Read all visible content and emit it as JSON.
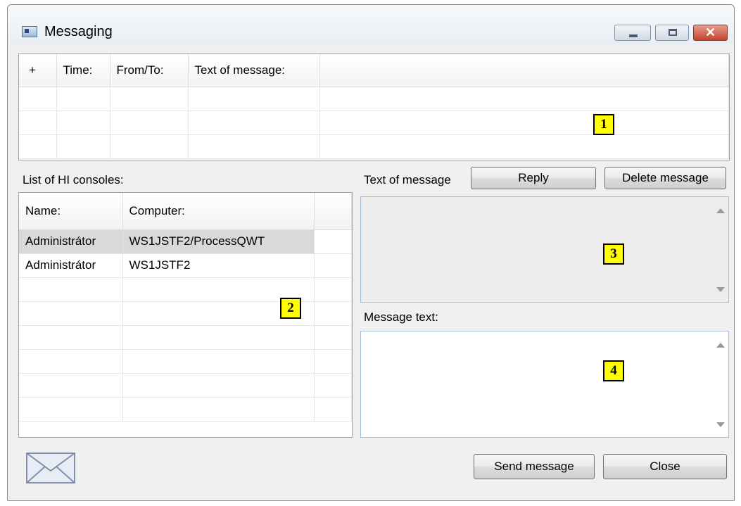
{
  "window": {
    "title": "Messaging"
  },
  "window_controls": {
    "close_glyph": "✕"
  },
  "messages_table": {
    "columns": [
      "+",
      "Time:",
      "From/To:",
      "Text of message:"
    ],
    "rows": []
  },
  "consoles": {
    "label": "List of HI consoles:",
    "columns": [
      "Name:",
      "Computer:"
    ],
    "rows": [
      {
        "name": "Administrátor",
        "computer": "WS1JSTF2/ProcessQWT",
        "selected": true
      },
      {
        "name": "Administrátor",
        "computer": "WS1JSTF2",
        "selected": false
      }
    ]
  },
  "received": {
    "label": "Text of message",
    "reply_mnemonic": "R",
    "reply_rest": "eply",
    "delete_label": "Delete message"
  },
  "compose": {
    "label": "Message text:"
  },
  "footer": {
    "send_mnemonic": "S",
    "send_rest": "end message",
    "close_mnemonic": "C",
    "close_rest": "lose"
  },
  "markers": [
    "1",
    "2",
    "3",
    "4"
  ],
  "icons": {
    "envelope": "envelope-icon",
    "app": "messaging-app-icon"
  },
  "colors": {
    "marker_fill": "#ffff00",
    "selected_row": "#d9d9d9",
    "window_bg": "#f0f0f0"
  }
}
